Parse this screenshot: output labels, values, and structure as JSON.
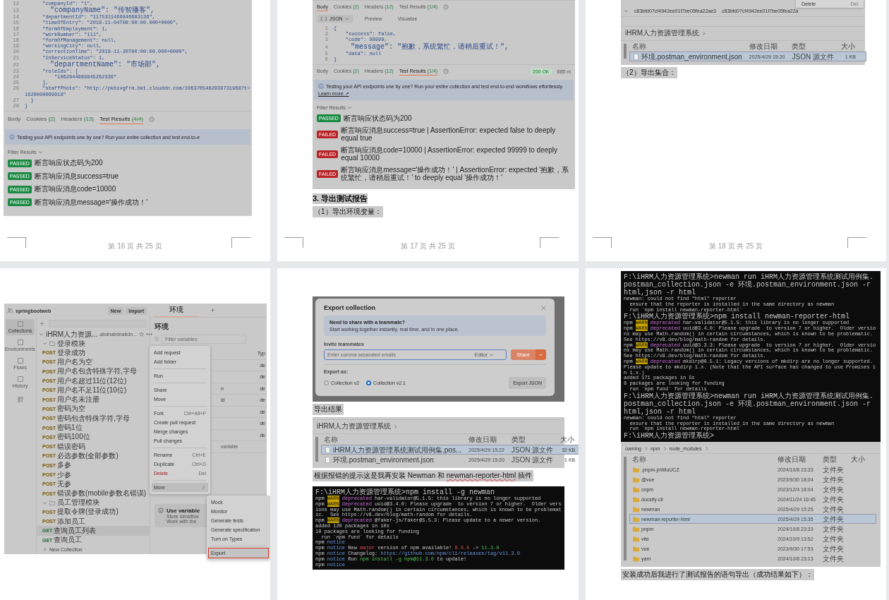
{
  "pages": [
    {
      "footer": "第 16 页 共 25 页",
      "blocks": [
        {
          "kind": "code",
          "lines": [
            {
              "n": "12",
              "text": "      \"companyId\": \"1\","
            },
            {
              "n": "13",
              "text": "      \"companyName\": \"传智播客\","
            },
            {
              "n": "14",
              "text": "      \"departmentId\": \"1175311466846683136\","
            },
            {
              "n": "15",
              "text": "      \"timeOfEntry\": \"2018-11-04T08:00:00.000+0000\","
            },
            {
              "n": "16",
              "text": "      \"formOfEmployment\": 1,"
            },
            {
              "n": "17",
              "text": "      \"workNumber\": \"111\","
            },
            {
              "n": "18",
              "text": "      \"formOfManagement\": null,"
            },
            {
              "n": "19",
              "text": "      \"workingCity\": null,"
            },
            {
              "n": "20",
              "text": "      \"correctionTime\": \"2018-11-20T00:00:00.000+0000\","
            },
            {
              "n": "21",
              "text": "      \"inServiceStatus\": 1,"
            },
            {
              "n": "22",
              "text": "      \"departmentName\": \"市场部\","
            },
            {
              "n": "23",
              "text": "      \"roleIds\": ["
            },
            {
              "n": "24",
              "text": "          \"1062944989845262336\""
            },
            {
              "n": "25",
              "text": "      ],"
            },
            {
              "n": "26",
              "text": "      \"staffPhoto\": \"http://pkbivgfrm.bkt.clouddn.com/1063705482939731968?t=1620000069918\""
            },
            {
              "n": "27",
              "text": "  }"
            },
            {
              "n": "28",
              "text": "}"
            }
          ]
        },
        {
          "kind": "result_tabs",
          "tabs": [
            {
              "label": "Body",
              "selected": false
            },
            {
              "label": "Cookies",
              "count": "(2)",
              "selected": false
            },
            {
              "label": "Headers",
              "count": "(13)",
              "selected": false
            },
            {
              "label": "Test Results",
              "count": "(4/4)",
              "selected": true
            }
          ]
        },
        {
          "kind": "banner",
          "text": "Testing your API endpoints one by one? Run your entire collection and test end-to-e"
        },
        {
          "kind": "filter",
          "label": "Filter Results"
        },
        {
          "kind": "tests",
          "items": [
            {
              "passed": true,
              "status": "PASSED",
              "text": "断言响应状态码为200"
            },
            {
              "passed": true,
              "status": "PASSED",
              "text": "断言响应消息success=true"
            },
            {
              "passed": true,
              "status": "PASSED",
              "text": "断言响应消息code=10000"
            },
            {
              "passed": true,
              "status": "PASSED",
              "text": "断言响应消息message='操作成功！'"
            }
          ]
        }
      ]
    },
    {
      "footer": "第 17 页 共 25 页",
      "blocks": [
        {
          "kind": "result_tabs",
          "tabs": [
            {
              "label": "Body",
              "selected": true
            },
            {
              "label": "Cookies",
              "count": "(2)",
              "selected": false
            },
            {
              "label": "Headers",
              "count": "(12)",
              "selected": false
            },
            {
              "label": "Test Results",
              "count": "(1/4)",
              "selected": false
            }
          ]
        },
        {
          "kind": "json_toolbar",
          "format": "JSON",
          "buttons": [
            "Preview",
            "Visualize"
          ]
        },
        {
          "kind": "code",
          "lines": [
            {
              "n": "1",
              "text": "{"
            },
            {
              "n": "2",
              "text": "    \"success\": false,"
            },
            {
              "n": "3",
              "text": "    \"code\": 99999,"
            },
            {
              "n": "4",
              "text": "    \"message\": \"抱歉，系统繁忙，请稍后重试！\","
            },
            {
              "n": "5",
              "text": "    \"data\": null"
            },
            {
              "n": "6",
              "text": "}"
            }
          ]
        },
        {
          "kind": "result_tabs",
          "status": "200 OK",
          "time": "885 m",
          "tabs": [
            {
              "label": "Body",
              "selected": false
            },
            {
              "label": "Cookies",
              "count": "(2)",
              "selected": false
            },
            {
              "label": "Headers",
              "count": "(12)",
              "selected": false
            },
            {
              "label": "Test Results",
              "count": "(1/4)",
              "selected": true
            }
          ]
        },
        {
          "kind": "banner",
          "text": "Testing your API endpoints one by one? Run your entire collection and test end-to-end workflows effortlessly.",
          "link": "Learn more ↗"
        },
        {
          "kind": "filter",
          "label": "Filter Results"
        },
        {
          "kind": "tests",
          "items": [
            {
              "passed": true,
              "status": "PASSED",
              "text": "断言响应状态码为200"
            },
            {
              "passed": false,
              "status": "FAILED",
              "text": "断言响应消息success=true | AssertionError: expected false to deeply equal true"
            },
            {
              "passed": false,
              "status": "FAILED",
              "text": "断言响应消息code=10000 | AssertionError: expected 99999 to deeply equal 10000"
            },
            {
              "passed": false,
              "status": "FAILED",
              "text": "断言响应消息message='操作成功！' | AssertionError: expected '抱歉，系统繁忙，请稍后重试！' to deeply equal '操作成功！'"
            }
          ]
        },
        {
          "kind": "heading",
          "text": "3. 导出测试报告"
        },
        {
          "kind": "paragraph",
          "text": "（1）导出环境变量："
        }
      ]
    },
    {
      "footer": "第 18 页 共 25 页",
      "blocks": [
        {
          "kind": "hash_row",
          "cells": [
            "c83bfd07cf4942ee01f7be05fea22ae3",
            "c83bfd07cf4942ee01f7be05fea22a"
          ],
          "menu_item": "Delete",
          "menu_shortcut": "Del"
        },
        {
          "kind": "explorer",
          "breadcrumb": [
            "iHRM人力资源管理系统"
          ],
          "columns": [
            "名称",
            "修改日期",
            "类型",
            "大小"
          ],
          "rows": [
            {
              "kind": "file",
              "name": "环境.postman_environment.json",
              "date": "2025/4/29 15:20",
              "type": "JSON 源文件",
              "size": "1 KB",
              "selected": true
            }
          ]
        },
        {
          "kind": "paragraph",
          "text": "（2）导出集合："
        }
      ]
    },
    {
      "blocks": [
        {
          "kind": "postman",
          "workspace": "springbootweb",
          "header_buttons": [
            "New",
            "Import"
          ],
          "rail": [
            {
              "label": "Collections",
              "selected": true
            },
            {
              "label": "Environments",
              "selected": false
            },
            {
              "label": "Flows",
              "selected": false
            },
            {
              "label": "History",
              "selected": false
            }
          ],
          "tab": "环境",
          "collection": "iHRM人力资源...",
          "fork": "abdnabdnabdn...",
          "folders": [
            {
              "name": "登录模块",
              "expanded": true,
              "requests": [
                {
                  "method": "POST",
                  "name": "登录成功",
                  "selected": false
                },
                {
                  "method": "POST",
                  "name": "用户名为空",
                  "selected": false
                },
                {
                  "method": "POST",
                  "name": "用户名包含特殊字符,字母",
                  "selected": false
                },
                {
                  "method": "POST",
                  "name": "用户名超过11位(12位)",
                  "selected": false
                },
                {
                  "method": "POST",
                  "name": "用户名不足11位(10位)",
                  "selected": false
                },
                {
                  "method": "POST",
                  "name": "用户名未注册",
                  "selected": false
                },
                {
                  "method": "POST",
                  "name": "密码为空",
                  "selected": false
                },
                {
                  "method": "POST",
                  "name": "密码包含特殊字符,字母",
                  "selected": false
                },
                {
                  "method": "POST",
                  "name": "密码1位",
                  "selected": false
                },
                {
                  "method": "POST",
                  "name": "密码100位",
                  "selected": false
                },
                {
                  "method": "POST",
                  "name": "错误密码",
                  "selected": false
                },
                {
                  "method": "POST",
                  "name": "必选参数(全部参数)",
                  "selected": false
                },
                {
                  "method": "POST",
                  "name": "多参",
                  "selected": false
                },
                {
                  "method": "POST",
                  "name": "少参",
                  "selected": false
                },
                {
                  "method": "POST",
                  "name": "无参",
                  "selected": false
                },
                {
                  "method": "POST",
                  "name": "错误参数(mobile参数名错误)",
                  "selected": false
                }
              ]
            },
            {
              "name": "员工管理模块",
              "expanded": true,
              "requests": [
                {
                  "method": "POST",
                  "name": "提取令牌(登录成功)",
                  "selected": false
                },
                {
                  "method": "POST",
                  "name": "添加员工",
                  "selected": false
                },
                {
                  "method": "GET",
                  "name": "查询员工列表",
                  "selected": true
                },
                {
                  "method": "GET",
                  "name": "查询员工",
                  "selected": false
                }
              ]
            }
          ],
          "other_collection": "New Collection",
          "env_title": "环境",
          "env_search": {
            "placeholder": "Filter variables"
          },
          "env_column": "Typ",
          "env_rows": [
            {
              "type": "de"
            },
            {
              "type": "de"
            },
            {
              "key": "n",
              "type": "de"
            },
            {
              "key": "id",
              "type": "de"
            },
            {
              "type": "de"
            },
            {
              "type": "de"
            },
            {
              "type": "de"
            }
          ],
          "env_add": "variable",
          "hint_title": "Use variable",
          "hint_lines": [
            "Store sensitive",
            "Work with the"
          ],
          "menu": [
            [
              {
                "label": "Add request",
                "kind": "plain",
                "selected": false
              },
              {
                "label": "Add folder",
                "kind": "plain",
                "selected": false
              }
            ],
            [
              {
                "label": "Run",
                "kind": "plain",
                "selected": false
              }
            ],
            [
              {
                "label": "Share",
                "kind": "plain",
                "selected": false
              },
              {
                "label": "Move",
                "kind": "plain",
                "selected": false
              }
            ],
            [
              {
                "label": "Fork",
                "shortcut": "Ctrl+Alt+F",
                "kind": "plain",
                "selected": false
              },
              {
                "label": "Create pull request",
                "kind": "plain",
                "selected": false
              },
              {
                "label": "Merge changes",
                "kind": "plain",
                "selected": false
              },
              {
                "label": "Pull changes",
                "kind": "plain",
                "selected": false
              }
            ],
            [
              {
                "label": "Rename",
                "shortcut": "Ctrl+E",
                "kind": "plain",
                "selected": false
              },
              {
                "label": "Duplicate",
                "shortcut": "Ctrl+D",
                "kind": "plain",
                "selected": false
              },
              {
                "label": "Delete",
                "shortcut": "Del",
                "kind": "danger",
                "selected": false
              }
            ],
            [
              {
                "label": "More",
                "kind": "submenu",
                "selected": true
              }
            ]
          ],
          "submenu": [
            {
              "label": "Mock",
              "selected": false
            },
            {
              "label": "Monitor",
              "selected": false
            },
            {
              "label": "Generate tests",
              "selected": false
            },
            {
              "label": "Generate specification",
              "selected": false
            },
            {
              "label": "Turn on Types",
              "selected": false
            },
            {
              "label": "Export",
              "selected": true
            }
          ]
        }
      ]
    },
    {
      "blocks": [
        {
          "kind": "export_dialog",
          "title": "Export collection",
          "share_title": "Need to share with a teammate?",
          "share_text": "Start working together instantly, real time, and in one place.",
          "invite_label": "Invite teammates",
          "invite_placeholder": "Enter comma separated emails",
          "role": "Editor",
          "share_button": "Share",
          "export_label": "Export as:",
          "options": [
            {
              "label": "Collection v2",
              "selected": false
            },
            {
              "label": "Collection v2.1",
              "selected": true
            }
          ],
          "export_button": "Export JSON"
        },
        {
          "kind": "paragraph",
          "text": "导出结果"
        },
        {
          "kind": "explorer",
          "breadcrumb": [
            "iHRM人力资源管理系统"
          ],
          "columns": [
            "名称",
            "修改日期",
            "类型",
            "大小"
          ],
          "rows": [
            {
              "kind": "file",
              "name": "iHRM人力资源管理系统测试用例集.pos...",
              "date": "2025/4/29 15:22",
              "type": "JSON 源文件",
              "size": "32 KB",
              "selected": true
            },
            {
              "kind": "file",
              "name": "环境.postman_environment.json",
              "date": "2025/4/29 15:20",
              "type": "JSON 源文件",
              "size": "1 KB",
              "selected": false
            }
          ]
        },
        {
          "kind": "paragraph",
          "text": "根据报错的提示这是我再安装 Newman 和 ",
          "flagged": "newman-reporter-html",
          "after": " 插件"
        },
        {
          "kind": "terminal",
          "lines": [
            [
              {
                "text": "F:\\iHRM人力资源管理系统>npm install -g newman",
                "kind": "plain"
              }
            ],
            [
              {
                "text": "npm ",
                "kind": "plain"
              },
              {
                "text": "WARN",
                "kind": "warn"
              },
              {
                "text": " deprecated",
                "kind": "dep"
              },
              {
                "text": " har-validator@5.1.5: this library is no longer supported",
                "kind": "plain"
              }
            ],
            [
              {
                "text": "npm ",
                "kind": "plain"
              },
              {
                "text": "WARN",
                "kind": "warn"
              },
              {
                "text": " deprecated",
                "kind": "dep"
              },
              {
                "text": " uuid@3.4.0: Please upgrade  to version 7 or higher.  Older versions may use Math.random() in certain circumstances, which is known to be problematic.  See https://v8.dev/blog/math-random for details.",
                "kind": "plain"
              }
            ],
            [
              {
                "text": "npm ",
                "kind": "plain"
              },
              {
                "text": "WARN",
                "kind": "warn"
              },
              {
                "text": " deprecated",
                "kind": "dep"
              },
              {
                "text": " @faker-js/faker@5.5.3: Please update to a newer version.",
                "kind": "plain"
              }
            ],
            [
              {
                "text": "added 120 packages in 10s",
                "kind": "plain"
              }
            ],
            [
              {
                "text": "10 packages are looking for funding",
                "kind": "plain"
              }
            ],
            [
              {
                "text": "  run `npm fund` for details",
                "kind": "plain"
              }
            ],
            [
              {
                "text": "npm ",
                "kind": "plain"
              },
              {
                "text": "notice",
                "kind": "notice"
              }
            ],
            [
              {
                "text": "npm ",
                "kind": "plain"
              },
              {
                "text": "notice",
                "kind": "notice"
              },
              {
                "text": " New ",
                "kind": "plain"
              },
              {
                "text": "major",
                "kind": "red"
              },
              {
                "text": " version of npm available! ",
                "kind": "plain"
              },
              {
                "text": "8.5.5",
                "kind": "red"
              },
              {
                "text": " -> ",
                "kind": "plain"
              },
              {
                "text": "11.3.0",
                "kind": "green"
              }
            ],
            [
              {
                "text": "npm ",
                "kind": "plain"
              },
              {
                "text": "notice",
                "kind": "notice"
              },
              {
                "text": " Changelog: ",
                "kind": "plain"
              },
              {
                "text": "https://github.com/npm/cli/releases/tag/v11.3.0",
                "kind": "notice"
              }
            ],
            [
              {
                "text": "npm ",
                "kind": "plain"
              },
              {
                "text": "notice",
                "kind": "notice"
              },
              {
                "text": " Run ",
                "kind": "plain"
              },
              {
                "text": "npm install -g npm@11.3.0",
                "kind": "green"
              },
              {
                "text": " to update!",
                "kind": "plain"
              }
            ],
            [
              {
                "text": "npm ",
                "kind": "plain"
              },
              {
                "text": "notice",
                "kind": "notice"
              }
            ]
          ]
        }
      ]
    },
    {
      "blocks": [
        {
          "kind": "terminal",
          "lines": [
            [
              {
                "text": "F:\\iHRM人力资源管理系统>newman run iHRM人力资源管理系统测试用例集.postman_collection.json -e 环境.postman_environment.json -r html,json -r html",
                "kind": "plain"
              }
            ],
            [
              {
                "text": "newman: could not find \"html\" reporter",
                "kind": "plain"
              }
            ],
            [
              {
                "text": "  ensure that the reporter is installed in the same directory as newman",
                "kind": "plain"
              }
            ],
            [
              {
                "text": "  run `npm install newman-reporter-html`",
                "kind": "plain"
              }
            ],
            [
              {
                "text": "F:\\iHRM人力资源管理系统>npm install newman-reporter-html",
                "kind": "plain"
              }
            ],
            [
              {
                "text": "npm ",
                "kind": "plain"
              },
              {
                "text": "WARN",
                "kind": "warn"
              },
              {
                "text": " deprecated",
                "kind": "dep"
              },
              {
                "text": " har-validator@5.1.5: this library is no longer supported",
                "kind": "plain"
              }
            ],
            [
              {
                "text": "npm ",
                "kind": "plain"
              },
              {
                "text": "WARN",
                "kind": "warn"
              },
              {
                "text": " deprecated",
                "kind": "dep"
              },
              {
                "text": " uuid@3.4.0: Please upgrade  to version 7 or higher.  Older versions may use Math.random() in certain circumstances, which is known to be problematic.  See https://v8.dev/blog/math-random for details.",
                "kind": "plain"
              }
            ],
            [
              {
                "text": "npm ",
                "kind": "plain"
              },
              {
                "text": "WARN",
                "kind": "warn"
              },
              {
                "text": " deprecated",
                "kind": "dep"
              },
              {
                "text": " uuid@3.3.3: Please upgrade  to version 7 or higher.  Older versions may use Math.random() in certain circumstances, which is known to be problematic.  See https://v8.dev/blog/math-random for details.",
                "kind": "plain"
              }
            ],
            [
              {
                "text": "npm ",
                "kind": "plain"
              },
              {
                "text": "WARN",
                "kind": "warn"
              },
              {
                "text": " deprecated",
                "kind": "dep"
              },
              {
                "text": " mkdirp@0.5.1: Legacy versions of mkdirp are no longer supported. Please update to mkdirp 1.x. (Note that the API surface has changed to use Promises in 1.x.)",
                "kind": "plain"
              }
            ],
            [
              {
                "text": "added 171 packages in 5s",
                "kind": "plain"
              }
            ],
            [
              {
                "text": "8 packages are looking for funding",
                "kind": "plain"
              }
            ],
            [
              {
                "text": "  run `npm fund` for details",
                "kind": "plain"
              }
            ],
            [
              {
                "text": "F:\\iHRM人力资源管理系统>newman run iHRM人力资源管理系统测试用例集.postman_collection.json -e 环境.postman_environment.json -r html,json -r html",
                "kind": "plain"
              }
            ],
            [
              {
                "text": "newman: could not find \"html\" reporter",
                "kind": "plain"
              }
            ],
            [
              {
                "text": "  ensure that the reporter is installed in the same directory as newman",
                "kind": "plain"
              }
            ],
            [
              {
                "text": "  run `npm install newman-reporter-html`",
                "kind": "plain"
              }
            ],
            [
              {
                "text": "F:\\iHRM人力资源管理系统>",
                "kind": "plain"
              }
            ]
          ]
        },
        {
          "kind": "explorer",
          "breadcrumb": [
            "oaming",
            "npm",
            "node_modules"
          ],
          "columns": [
            "名称",
            "修改日期",
            "类型",
            "大小"
          ],
          "rows": [
            {
              "kind": "folder",
              "name": ".pnpm-jnWluUCZ",
              "date": "2024/10/8 23:33",
              "type": "文件夹",
              "selected": false
            },
            {
              "kind": "folder",
              "name": "@vue",
              "date": "2023/9/30 18:04",
              "type": "文件夹",
              "selected": false
            },
            {
              "kind": "folder",
              "name": "cnpm",
              "date": "2023/12/4 18:04",
              "type": "文件夹",
              "selected": false
            },
            {
              "kind": "folder",
              "name": "docsify-cli",
              "date": "2024/11/24 16:45",
              "type": "文件夹",
              "selected": false
            },
            {
              "kind": "folder",
              "name": "newman",
              "date": "2025/4/29 15:25",
              "type": "文件夹",
              "selected": false
            },
            {
              "kind": "folder",
              "name": "newman-reporter-html",
              "date": "2025/4/29 15:35",
              "type": "文件夹",
              "selected": true
            },
            {
              "kind": "folder",
              "name": "pnpm",
              "date": "2024/10/8 23:33",
              "type": "文件夹",
              "selected": false
            },
            {
              "kind": "folder",
              "name": "vite",
              "date": "2024/10/9 13:52",
              "type": "文件夹",
              "selected": false
            },
            {
              "kind": "folder",
              "name": "vue",
              "date": "2023/9/30 17:53",
              "type": "文件夹",
              "selected": false
            },
            {
              "kind": "folder",
              "name": "yarn",
              "date": "2024/10/8 23:13",
              "type": "文件夹",
              "selected": false
            }
          ]
        },
        {
          "kind": "paragraph",
          "text": "安装成功后我进行了测试报告的语句导出（成功结果如下）："
        }
      ]
    }
  ]
}
